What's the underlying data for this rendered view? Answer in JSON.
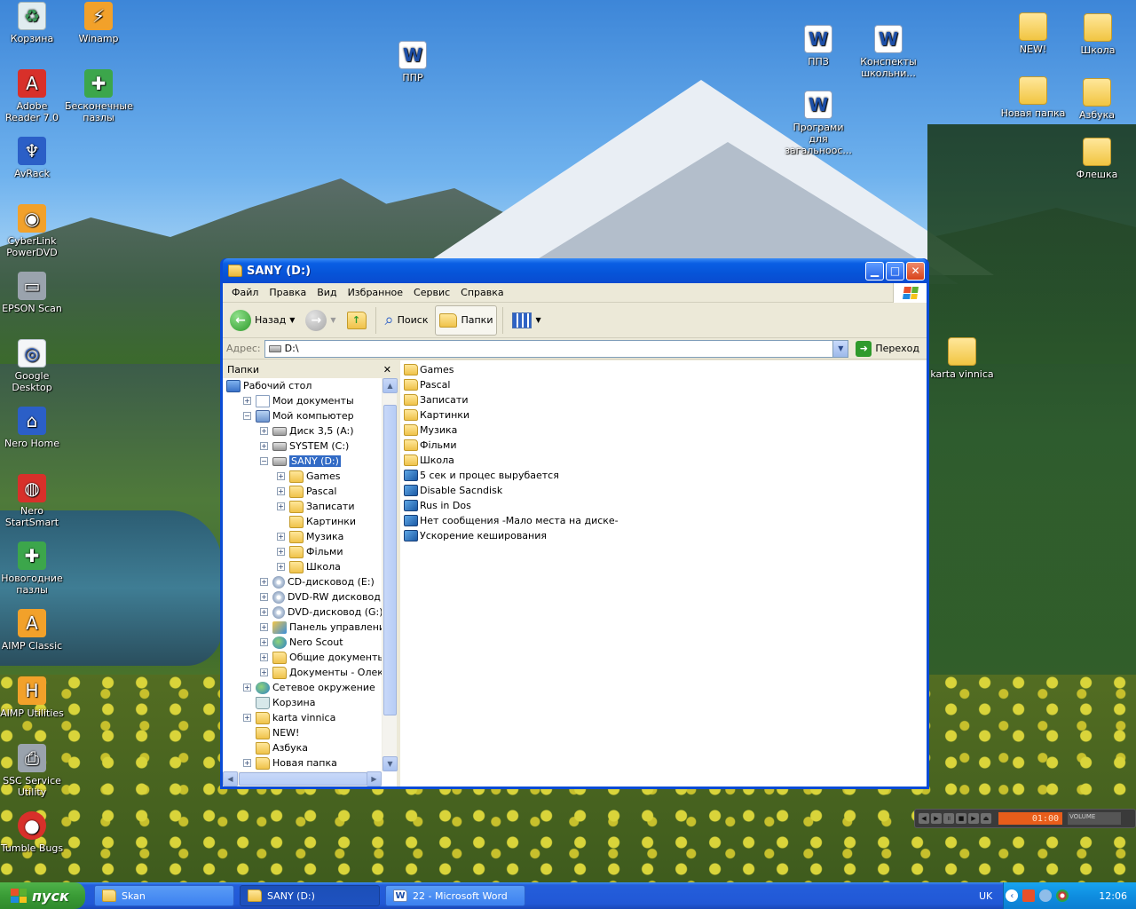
{
  "desktop": {
    "left_icons": [
      {
        "label": "Корзина",
        "icon": "recycle-bin-icon"
      },
      {
        "label": "Winamp",
        "icon": "winamp-icon"
      },
      {
        "label": "Adobe Reader 7.0",
        "icon": "adobe-reader-icon"
      },
      {
        "label": "Бесконечные пазлы",
        "icon": "puzzle-icon"
      },
      {
        "label": "AvRack",
        "icon": "avrack-icon"
      },
      {
        "label": "CyberLink PowerDVD",
        "icon": "powerdvd-icon"
      },
      {
        "label": "EPSON Scan",
        "icon": "scanner-icon"
      },
      {
        "label": "Google Desktop",
        "icon": "google-desktop-icon"
      },
      {
        "label": "Nero Home",
        "icon": "nero-home-icon"
      },
      {
        "label": "Nero StartSmart",
        "icon": "nero-startsmart-icon"
      },
      {
        "label": "Новогодние пазлы",
        "icon": "puzzle-icon"
      },
      {
        "label": "AIMP Classic",
        "icon": "aimp-icon"
      },
      {
        "label": "AIMP Utilities",
        "icon": "aimp-utilities-icon"
      },
      {
        "label": "SSC Service Utility",
        "icon": "printer-icon"
      },
      {
        "label": "Tumble Bugs",
        "icon": "ladybug-icon"
      }
    ],
    "doc_icons": [
      {
        "label": "ППР"
      },
      {
        "label": "ППЗ"
      },
      {
        "label": "Конспекты школьни..."
      },
      {
        "label": "Програми для загальноос..."
      }
    ],
    "folder_icons": [
      {
        "label": "NEW!"
      },
      {
        "label": "Школа"
      },
      {
        "label": "Новая папка"
      },
      {
        "label": "Азбука"
      },
      {
        "label": "Флешка"
      },
      {
        "label": "karta vinnica"
      }
    ]
  },
  "window": {
    "title": "SANY (D:)",
    "menu": [
      "Файл",
      "Правка",
      "Вид",
      "Избранное",
      "Сервис",
      "Справка"
    ],
    "toolbar": {
      "back": "Назад",
      "search": "Поиск",
      "folders": "Папки"
    },
    "address": {
      "label": "Адрес:",
      "value": "D:\\",
      "go": "Переход"
    },
    "folders_pane": {
      "title": "Папки",
      "tree": [
        {
          "label": "Рабочий стол",
          "level": 0,
          "pm": "",
          "icon": "desk"
        },
        {
          "label": "Мои документы",
          "level": 1,
          "pm": "+",
          "icon": "docs"
        },
        {
          "label": "Мой компьютер",
          "level": 1,
          "pm": "-",
          "icon": "pc"
        },
        {
          "label": "Диск 3,5 (A:)",
          "level": 2,
          "pm": "+",
          "icon": "drive"
        },
        {
          "label": "SYSTEM (C:)",
          "level": 2,
          "pm": "+",
          "icon": "drive"
        },
        {
          "label": "SANY (D:)",
          "level": 2,
          "pm": "-",
          "icon": "drive",
          "selected": true
        },
        {
          "label": "Games",
          "level": 3,
          "pm": "+",
          "icon": "folder"
        },
        {
          "label": "Pascal",
          "level": 3,
          "pm": "+",
          "icon": "folder"
        },
        {
          "label": "Записати",
          "level": 3,
          "pm": "+",
          "icon": "folder"
        },
        {
          "label": "Картинки",
          "level": 3,
          "pm": "",
          "icon": "folder"
        },
        {
          "label": "Музика",
          "level": 3,
          "pm": "+",
          "icon": "folder"
        },
        {
          "label": "Фільми",
          "level": 3,
          "pm": "+",
          "icon": "folder"
        },
        {
          "label": "Школа",
          "level": 3,
          "pm": "+",
          "icon": "folder"
        },
        {
          "label": "CD-дисковод (E:)",
          "level": 2,
          "pm": "+",
          "icon": "disc"
        },
        {
          "label": "DVD-RW дисковод (F:)",
          "level": 2,
          "pm": "+",
          "icon": "disc"
        },
        {
          "label": "DVD-дисковод (G:)",
          "level": 2,
          "pm": "+",
          "icon": "disc"
        },
        {
          "label": "Панель управления",
          "level": 2,
          "pm": "+",
          "icon": "panel"
        },
        {
          "label": "Nero Scout",
          "level": 2,
          "pm": "+",
          "icon": "net"
        },
        {
          "label": "Общие документы",
          "level": 2,
          "pm": "+",
          "icon": "folder"
        },
        {
          "label": "Документы - Олександр",
          "level": 2,
          "pm": "+",
          "icon": "folder"
        },
        {
          "label": "Сетевое окружение",
          "level": 1,
          "pm": "+",
          "icon": "net"
        },
        {
          "label": "Корзина",
          "level": 1,
          "pm": "",
          "icon": "bin"
        },
        {
          "label": "karta vinnica",
          "level": 1,
          "pm": "+",
          "icon": "folder"
        },
        {
          "label": "NEW!",
          "level": 1,
          "pm": "",
          "icon": "folder"
        },
        {
          "label": "Азбука",
          "level": 1,
          "pm": "",
          "icon": "folder"
        },
        {
          "label": "Новая папка",
          "level": 1,
          "pm": "+",
          "icon": "folder"
        }
      ]
    },
    "files": [
      {
        "name": "Games",
        "type": "folder"
      },
      {
        "name": "Pascal",
        "type": "folder"
      },
      {
        "name": "Записати",
        "type": "folder"
      },
      {
        "name": "Картинки",
        "type": "folder"
      },
      {
        "name": "Музика",
        "type": "folder"
      },
      {
        "name": "Фільми",
        "type": "folder"
      },
      {
        "name": "Школа",
        "type": "folder"
      },
      {
        "name": "5 сек и процес вырубается",
        "type": "reg"
      },
      {
        "name": "Disable Sacndisk",
        "type": "reg"
      },
      {
        "name": "Rus in Dos",
        "type": "reg"
      },
      {
        "name": "Нет сообщения -Мало места на диске-",
        "type": "reg"
      },
      {
        "name": "Ускорение кеширования",
        "type": "reg"
      }
    ]
  },
  "player": {
    "time": "01:00",
    "volume_label": "VOLUME"
  },
  "taskbar": {
    "start": "пуск",
    "tasks": [
      {
        "label": "Skan",
        "active": false
      },
      {
        "label": "SANY (D:)",
        "active": true
      },
      {
        "label": "22 - Microsoft Word",
        "active": false
      }
    ],
    "lang": "UK",
    "clock": "12:06"
  }
}
